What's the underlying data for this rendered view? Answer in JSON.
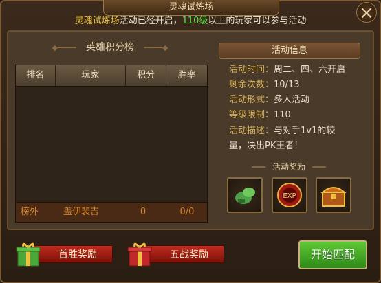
{
  "title": "灵魂试炼场",
  "subtitle": {
    "event": "灵魂试炼场",
    "text1": "活动已经开启，",
    "level": "110级",
    "text2": "以上的玩家可以参与活动"
  },
  "close_icon": "×",
  "leaderboard": {
    "title": "英雄积分榜",
    "columns": [
      "排名",
      "玩家",
      "积分",
      "胜率"
    ],
    "self_row": {
      "rank": "榜外",
      "player": "盖伊裴吉",
      "score": "0",
      "winrate": "0/0"
    }
  },
  "activity": {
    "header": "活动信息",
    "time_label": "活动时间：",
    "time_value": "周二、四、六开启",
    "remaining_label": "剩余次数：",
    "remaining_value": "10/13",
    "form_label": "活动形式：",
    "form_value": "多人活动",
    "level_label": "等级限制：",
    "level_value": "110",
    "desc_label": "活动描述：",
    "desc_value1": "与对手1v1的较",
    "desc_value2": "量，决出PK王者！",
    "rewards_title": "活动奖励"
  },
  "buttons": {
    "first_win": "首胜奖励",
    "five_battles": "五战奖励",
    "start_match": "开始匹配"
  },
  "reward_items": [
    "green-potion-icon",
    "exp-orb-icon",
    "treasure-chest-icon"
  ],
  "exp_text": "EXP"
}
